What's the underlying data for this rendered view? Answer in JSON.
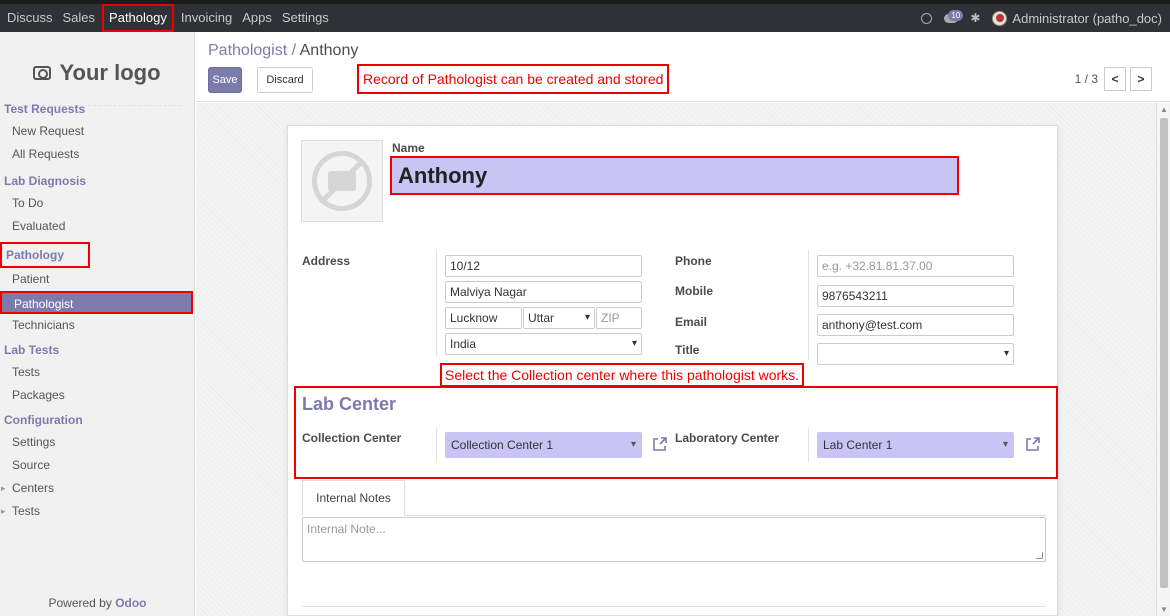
{
  "topbar": {
    "menu": [
      "Discuss",
      "Sales",
      "Pathology",
      "Invoicing",
      "Apps",
      "Settings"
    ],
    "active_menu": "Pathology",
    "message_count": "10",
    "user": "Administrator (patho_doc)"
  },
  "sidebar": {
    "logo_text": "Your logo",
    "sections": [
      {
        "header": "Test Requests",
        "items": [
          "New Request",
          "All Requests"
        ]
      },
      {
        "header": "Lab Diagnosis",
        "items": [
          "To Do",
          "Evaluated"
        ]
      },
      {
        "header": "Pathology",
        "items": [
          "Patient",
          "Pathologist",
          "Technicians"
        ]
      },
      {
        "header": "Lab Tests",
        "items": [
          "Tests",
          "Packages"
        ]
      },
      {
        "header": "Configuration",
        "items": [
          "Settings",
          "Source"
        ]
      }
    ],
    "collapsed": [
      "Centers",
      "Tests"
    ],
    "active_item": "Pathologist",
    "powered_by": "Powered by",
    "powered_brand": "Odoo"
  },
  "control": {
    "breadcrumb_parent": "Pathologist",
    "breadcrumb_sep": " / ",
    "breadcrumb_current": "Anthony",
    "save_label": "Save",
    "discard_label": "Discard",
    "pager": "1 / 3",
    "pager_prev": "<",
    "pager_next": ">"
  },
  "annotations": {
    "record_note": "Record of Pathologist can be created and stored",
    "collection_note": "Select the Collection center where this pathologist works."
  },
  "form": {
    "name_label": "Name",
    "name_value": "Anthony",
    "address_label": "Address",
    "street": "10/12",
    "street2": "Malviya Nagar",
    "city": "Lucknow",
    "state": "Uttar Prad",
    "zip_placeholder": "ZIP",
    "country": "India",
    "phone_label": "Phone",
    "phone_placeholder": "e.g. +32.81.81.37.00",
    "mobile_label": "Mobile",
    "mobile_value": "9876543211",
    "email_label": "Email",
    "email_value": "anthony@test.com",
    "title_label": "Title",
    "title_value": "",
    "lab_center_title": "Lab Center",
    "collection_center_label": "Collection Center",
    "collection_center_value": "Collection Center 1",
    "laboratory_center_label": "Laboratory Center",
    "laboratory_center_value": "Lab Center 1",
    "tab_label": "Internal Notes",
    "notes_placeholder": "Internal Note..."
  },
  "colors": {
    "brand": "#7c7bad",
    "highlight": "#e00000",
    "selected_field": "#c8c4f4"
  }
}
